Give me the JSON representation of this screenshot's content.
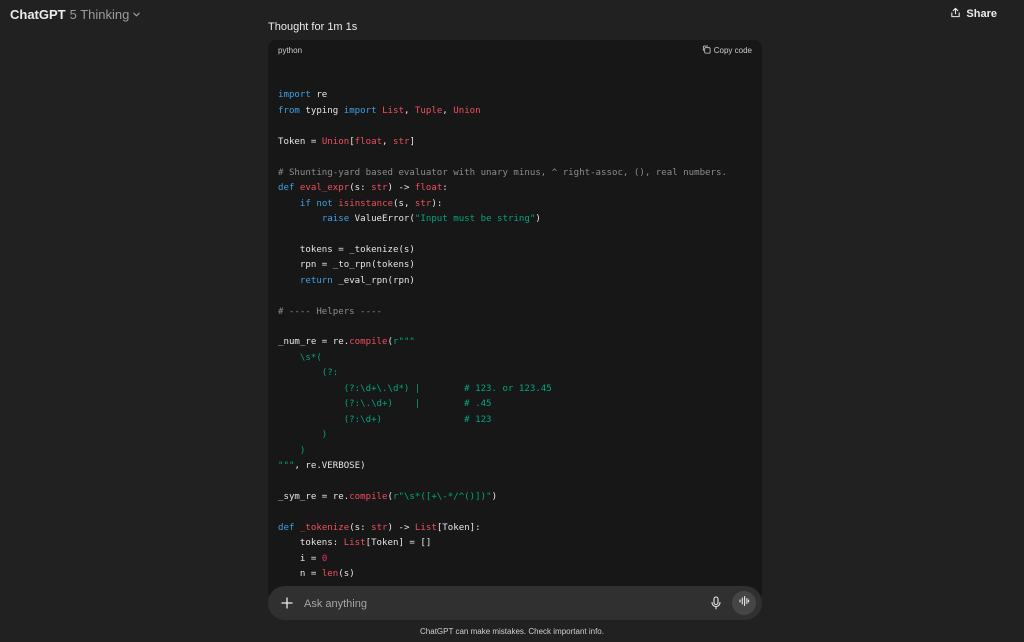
{
  "topbar": {
    "brand": "ChatGPT",
    "model_version": "5 Thinking",
    "share_label": "Share"
  },
  "thought_label": "Thought for 1m 1s",
  "code_block": {
    "language": "python",
    "copy_label": "Copy code",
    "lines": [
      [],
      [
        [
          "import",
          "kw"
        ],
        [
          " re",
          ""
        ]
      ],
      [
        [
          "from",
          "kw"
        ],
        [
          " typing ",
          ""
        ],
        [
          "import",
          "kw"
        ],
        [
          " ",
          ""
        ],
        [
          "List",
          "fn"
        ],
        [
          ", ",
          ""
        ],
        [
          "Tuple",
          "fn"
        ],
        [
          ", ",
          ""
        ],
        [
          "Union",
          "fn"
        ]
      ],
      [],
      [
        [
          "Token = ",
          ""
        ],
        [
          "Union",
          "fn"
        ],
        [
          "[",
          ""
        ],
        [
          "float",
          "fn"
        ],
        [
          ", ",
          ""
        ],
        [
          "str",
          "fn"
        ],
        [
          "]",
          ""
        ]
      ],
      [],
      [
        [
          "# Shunting-yard based evaluator with unary minus, ^ right-assoc, (), real numbers.",
          "cm"
        ]
      ],
      [
        [
          "def",
          "kw"
        ],
        [
          " ",
          ""
        ],
        [
          "eval_expr",
          "fn"
        ],
        [
          "(s: ",
          ""
        ],
        [
          "str",
          "fn"
        ],
        [
          ") -> ",
          ""
        ],
        [
          "float",
          "fn"
        ],
        [
          ":",
          ""
        ]
      ],
      [
        [
          "    ",
          ""
        ],
        [
          "if",
          "kw"
        ],
        [
          " ",
          ""
        ],
        [
          "not",
          "kw"
        ],
        [
          " ",
          ""
        ],
        [
          "isinstance",
          "fn"
        ],
        [
          "(s, ",
          ""
        ],
        [
          "str",
          "fn"
        ],
        [
          "):",
          ""
        ]
      ],
      [
        [
          "        ",
          ""
        ],
        [
          "raise",
          "kw"
        ],
        [
          " ValueError(",
          ""
        ],
        [
          "\"Input must be string\"",
          "str"
        ],
        [
          ")",
          ""
        ]
      ],
      [],
      [
        [
          "    tokens = _tokenize(s)",
          ""
        ]
      ],
      [
        [
          "    rpn = _to_rpn(tokens)",
          ""
        ]
      ],
      [
        [
          "    ",
          ""
        ],
        [
          "return",
          "kw"
        ],
        [
          " _eval_rpn(rpn)",
          ""
        ]
      ],
      [],
      [
        [
          "# ---- Helpers ----",
          "cm"
        ]
      ],
      [],
      [
        [
          "_num_re = re.",
          ""
        ],
        [
          "compile",
          "fn"
        ],
        [
          "(",
          ""
        ],
        [
          "r\"\"\"",
          "str"
        ]
      ],
      [
        [
          "    \\s*(",
          "str"
        ]
      ],
      [
        [
          "        (?:",
          "str"
        ]
      ],
      [
        [
          "            (?:\\d+\\.\\d*) |        # 123. or 123.45",
          "str"
        ]
      ],
      [
        [
          "            (?:\\.\\d+)    |        # .45",
          "str"
        ]
      ],
      [
        [
          "            (?:\\d+)               # 123",
          "str"
        ]
      ],
      [
        [
          "        )",
          "str"
        ]
      ],
      [
        [
          "    )",
          "str"
        ]
      ],
      [
        [
          "\"\"\"",
          "str"
        ],
        [
          ", re.VERBOSE)",
          ""
        ]
      ],
      [],
      [
        [
          "_sym_re = re.",
          ""
        ],
        [
          "compile",
          "fn"
        ],
        [
          "(",
          ""
        ],
        [
          "r\"\\s*([+\\-*/^()])\"",
          "str"
        ],
        [
          ")",
          ""
        ]
      ],
      [],
      [
        [
          "def",
          "kw"
        ],
        [
          " ",
          ""
        ],
        [
          "_tokenize",
          "fn"
        ],
        [
          "(s: ",
          ""
        ],
        [
          "str",
          "fn"
        ],
        [
          ") -> ",
          ""
        ],
        [
          "List",
          "fn"
        ],
        [
          "[Token]:",
          ""
        ]
      ],
      [
        [
          "    tokens: ",
          ""
        ],
        [
          "List",
          "fn"
        ],
        [
          "[Token] = []",
          ""
        ]
      ],
      [
        [
          "    i = ",
          ""
        ],
        [
          "0",
          "num"
        ]
      ],
      [
        [
          "    n = ",
          ""
        ],
        [
          "len",
          "fn"
        ],
        [
          "(s)",
          ""
        ]
      ]
    ]
  },
  "composer": {
    "placeholder": "Ask anything"
  },
  "icons": {
    "model_menu": "chevron-down-icon",
    "share": "share-icon",
    "copy": "copy-icon",
    "scroll_down": "arrow-down-icon",
    "attach": "plus-icon",
    "dictate": "microphone-icon",
    "voice_mode": "voice-waveform-icon"
  },
  "disclaimer": "ChatGPT can make mistakes. Check important info."
}
